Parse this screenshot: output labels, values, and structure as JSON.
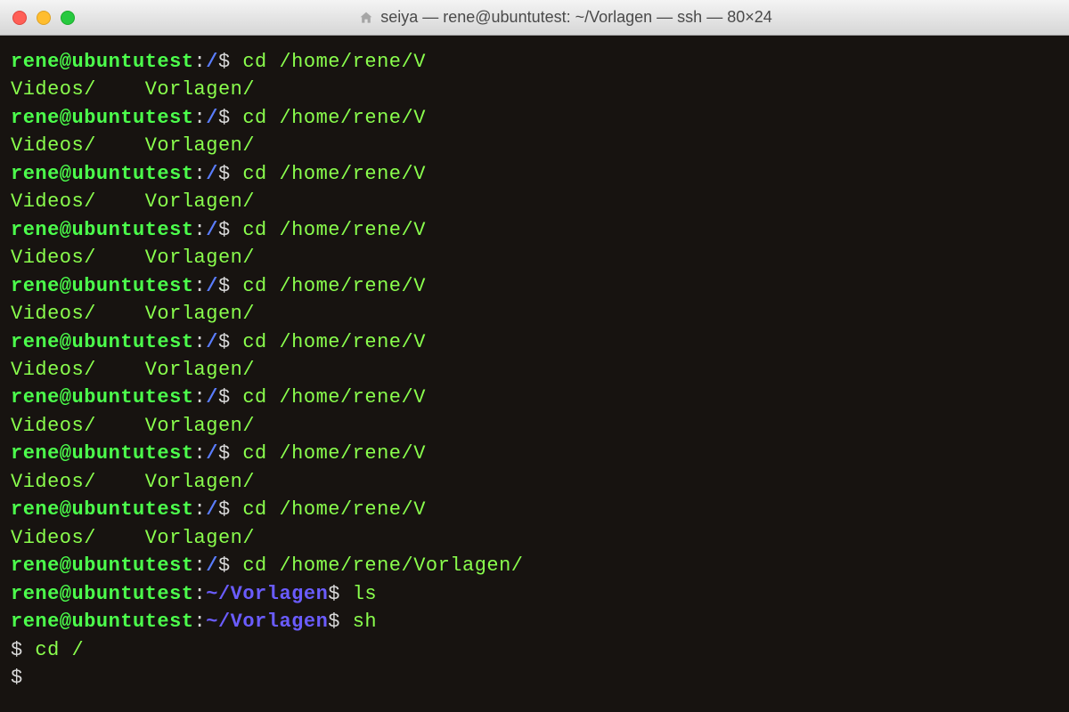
{
  "window": {
    "title": "seiya — rene@ubuntutest: ~/Vorlagen — ssh — 80×24"
  },
  "prompt": {
    "user_host": "rene@ubuntutest",
    "root_path": "/",
    "home_path": "~/Vorlagen",
    "dollar": "$"
  },
  "commands": {
    "cd_partial": "cd /home/rene/V",
    "cd_full": "cd /home/rene/Vorlagen/",
    "ls": "ls",
    "sh": "sh"
  },
  "completion": {
    "dir1": "Videos/",
    "spacer": "    ",
    "dir2": "Vorlagen/"
  },
  "shell": {
    "prompt": "$ ",
    "cmd1": "cd /",
    "cmd2": ""
  }
}
